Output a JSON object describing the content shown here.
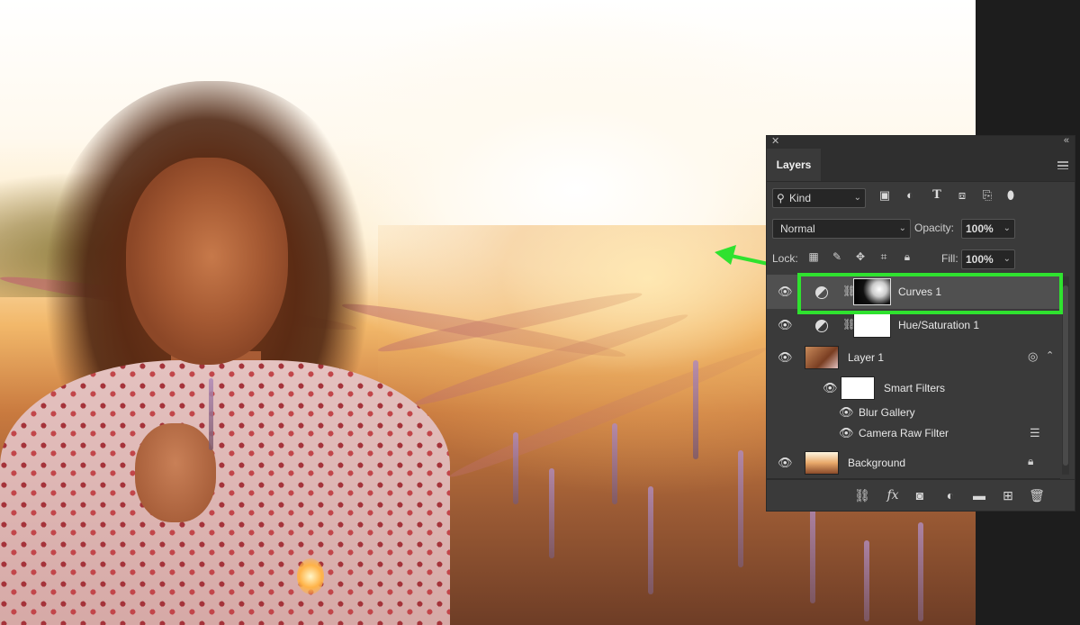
{
  "panel": {
    "title": "Layers",
    "close_icon": "close-icon",
    "collapse_icon": "double-chevron-icon",
    "filter": {
      "kind_label": "Kind",
      "icons": [
        "image-filter-icon",
        "adjustment-filter-icon",
        "type-filter-icon",
        "shape-filter-icon",
        "smart-object-filter-icon",
        "filter-toggle-icon"
      ]
    },
    "blend_mode": "Normal",
    "opacity_label": "Opacity:",
    "opacity_value": "100%",
    "lock_label": "Lock:",
    "fill_label": "Fill:",
    "fill_value": "100%",
    "layers": [
      {
        "name": "Curves 1",
        "type": "adjustment",
        "selected": true
      },
      {
        "name": "Hue/Saturation 1",
        "type": "adjustment",
        "selected": false
      },
      {
        "name": "Layer 1",
        "type": "smart-object",
        "selected": false
      },
      {
        "name": "Smart Filters",
        "type": "smart-filters",
        "selected": false
      },
      {
        "name": "Blur Gallery",
        "type": "filter",
        "selected": false
      },
      {
        "name": "Camera Raw Filter",
        "type": "filter",
        "selected": false
      },
      {
        "name": "Background",
        "type": "background",
        "selected": false
      }
    ],
    "footer_icons": [
      "link-layers-icon",
      "fx-icon",
      "add-mask-icon",
      "new-adjustment-icon",
      "new-group-icon",
      "new-layer-icon",
      "delete-icon"
    ],
    "fx_label": "fx"
  },
  "colors": {
    "highlight": "#2fe22f",
    "panel_bg": "#3a3a3a",
    "selected_row": "#505050"
  }
}
